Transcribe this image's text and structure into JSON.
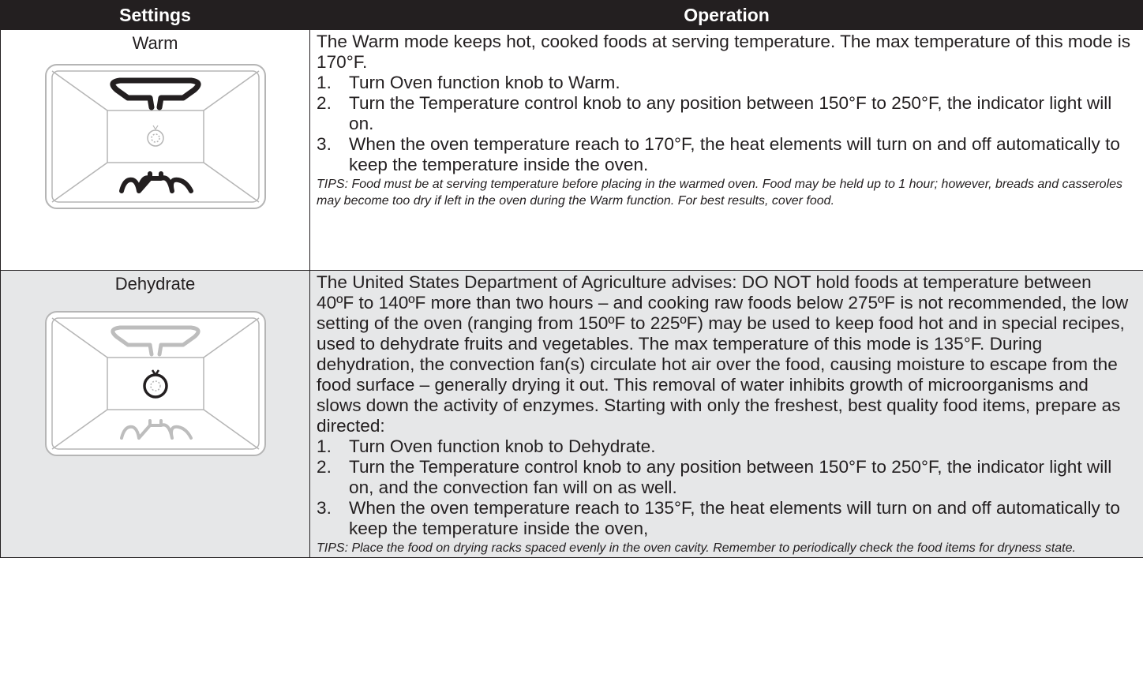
{
  "header": {
    "col1": "Settings",
    "col2": "Operation"
  },
  "rows": [
    {
      "setting": "Warm",
      "intro": "The Warm mode keeps hot, cooked foods at serving temperature. The max temperature of this mode is 170°F.",
      "steps": [
        {
          "num": "1.",
          "text": "Turn Oven function knob to Warm."
        },
        {
          "num": "2.",
          "text": "Turn the Temperature control knob to any position between 150°F to 250°F, the indicator light will on."
        },
        {
          "num": "3.",
          "text": "When the oven temperature reach to 170°F, the heat elements will turn on and off automatically to keep the temperature inside the oven."
        }
      ],
      "tips": "TIPS: Food must be at serving temperature before placing in the warmed oven. Food may be held up to 1 hour; however, breads and casseroles may become too dry if left in the oven during the Warm function. For best results, cover food."
    },
    {
      "setting": "Dehydrate",
      "intro": "The United States Department of Agriculture advises: DO NOT hold foods at temperature between 40ºF to 140ºF more than two hours – and cooking raw foods below 275ºF is not recommended, the low setting of the oven (ranging from 150ºF to 225ºF) may be used to keep food hot and in special recipes, used to dehydrate fruits and vegetables. The max temperature of this mode is 135°F. During dehydration, the convection fan(s) circulate hot air over the food, causing moisture to escape from the food surface – generally drying it out. This removal of water inhibits growth of microorganisms and slows down the activity of enzymes. Starting with only the freshest, best quality food items, prepare as directed:",
      "steps": [
        {
          "num": "1.",
          "text": "Turn Oven function knob to Dehydrate."
        },
        {
          "num": "2.",
          "text": "Turn the Temperature control knob to any position between 150°F to 250°F, the indicator light will on, and the convection fan will on as well."
        },
        {
          "num": "3.",
          "text": "When the oven temperature reach to 135°F, the heat elements will turn on and off automatically to keep the temperature inside the oven,"
        }
      ],
      "tips": "TIPS: Place the food on drying racks spaced evenly in the oven cavity. Remember to periodically check the food items for dryness state."
    }
  ],
  "icons": {
    "warm": "oven-warm-mode-icon",
    "dehydrate": "oven-dehydrate-mode-icon"
  },
  "colors": {
    "header_bg": "#231f20",
    "shaded_row": "#e6e7e8",
    "text": "#231f20"
  }
}
